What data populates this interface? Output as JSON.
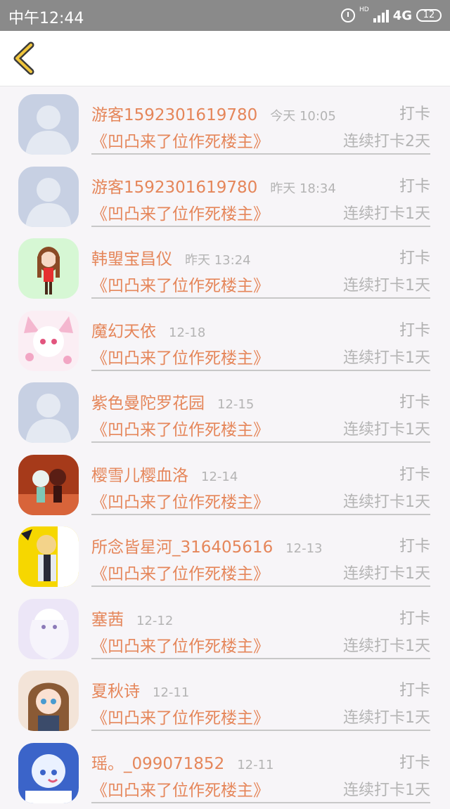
{
  "status": {
    "time": "中午12:44",
    "hd": "HD",
    "network": "4G",
    "battery": "12"
  },
  "entries": [
    {
      "name": "游客1592301619780",
      "time": "今天 10:05",
      "action": "打卡",
      "book": "《凹凸来了位作死楼主》",
      "streak": "连续打卡2天",
      "avatar": "default"
    },
    {
      "name": "游客1592301619780",
      "time": "昨天 18:34",
      "action": "打卡",
      "book": "《凹凸来了位作死楼主》",
      "streak": "连续打卡1天",
      "avatar": "default"
    },
    {
      "name": "韩琞宝昌仪",
      "time": "昨天 13:24",
      "action": "打卡",
      "book": "《凹凸来了位作死楼主》",
      "streak": "连续打卡1天",
      "avatar": "girl"
    },
    {
      "name": "魔幻天依",
      "time": "12-18",
      "action": "打卡",
      "book": "《凹凸来了位作死楼主》",
      "streak": "连续打卡1天",
      "avatar": "pink"
    },
    {
      "name": "紫色曼陀罗花园",
      "time": "12-15",
      "action": "打卡",
      "book": "《凹凸来了位作死楼主》",
      "streak": "连续打卡1天",
      "avatar": "default"
    },
    {
      "name": "樱雪儿樱血洛",
      "time": "12-14",
      "action": "打卡",
      "book": "《凹凸来了位作死楼主》",
      "streak": "连续打卡1天",
      "avatar": "red"
    },
    {
      "name": "所念皆星河_316405616",
      "time": "12-13",
      "action": "打卡",
      "book": "《凹凸来了位作死楼主》",
      "streak": "连续打卡1天",
      "avatar": "yellow"
    },
    {
      "name": "塞茜",
      "time": "12-12",
      "action": "打卡",
      "book": "《凹凸来了位作死楼主》",
      "streak": "连续打卡1天",
      "avatar": "lavender"
    },
    {
      "name": "夏秋诗",
      "time": "12-11",
      "action": "打卡",
      "book": "《凹凸来了位作死楼主》",
      "streak": "连续打卡1天",
      "avatar": "brown"
    },
    {
      "name": "瑶。_099071852",
      "time": "12-11",
      "action": "打卡",
      "book": "《凹凸来了位作死楼主》",
      "streak": "连续打卡1天",
      "avatar": "blue"
    }
  ]
}
